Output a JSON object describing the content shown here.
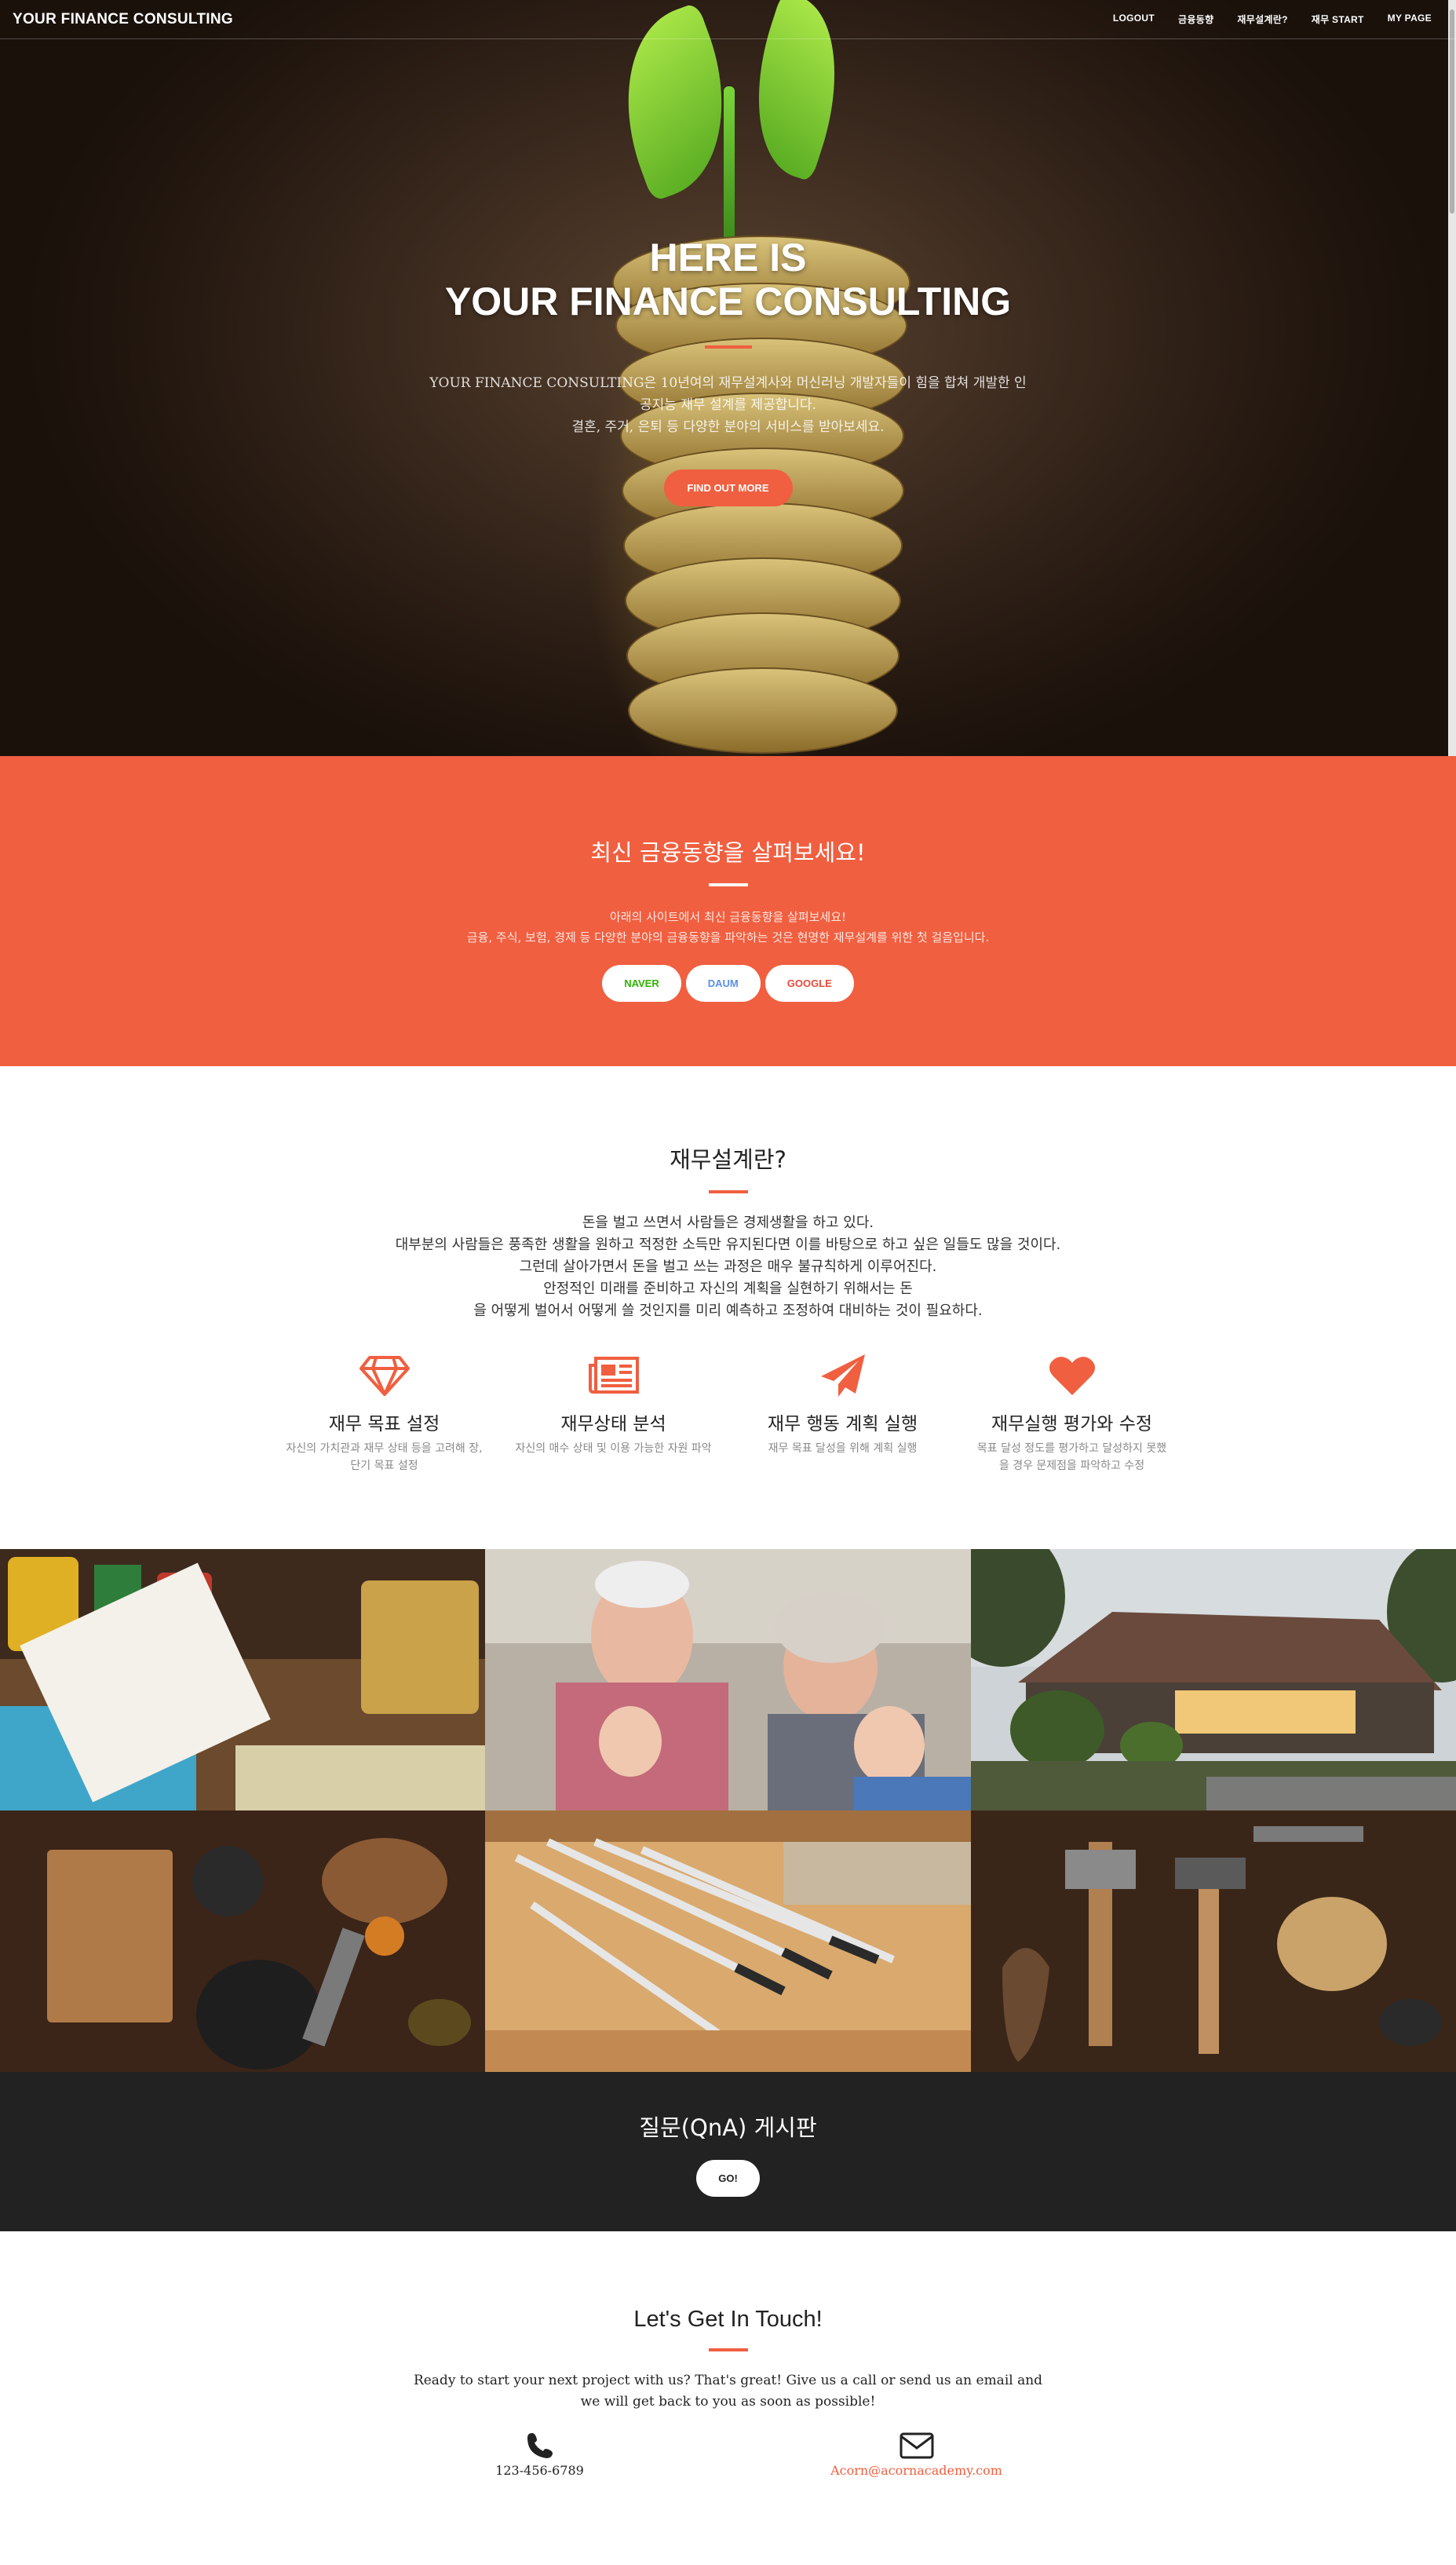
{
  "navbar": {
    "brand": "YOUR FINANCE CONSULTING",
    "links": [
      "LOGOUT",
      "금융동향",
      "재무설계란?",
      "재무 START",
      "MY PAGE"
    ]
  },
  "hero": {
    "title_line1": "HERE IS",
    "title_line2": "YOUR FINANCE CONSULTING",
    "text_line1": "YOUR FINANCE CONSULTING은 10년여의 재무설계사와 머신러닝 개발자들이 힘을 합쳐 개발한 인",
    "text_line2": "공지능 재무 설계를 제공합니다.",
    "text_line3": "결혼, 주거, 은퇴 등 다양한 분야의 서비스를 받아보세요.",
    "cta": "FIND OUT MORE"
  },
  "trends": {
    "title": "최신 금융동향을 살펴보세요!",
    "text_line1": "아래의 사이트에서 최신 금융동향을 살펴보세요!",
    "text_line2": "금융, 주식, 보험, 경제 등 다양한 분야의 금융동향을 파악하는 것은 현명한 재무설계를 위한 첫 걸음입니다.",
    "buttons": [
      {
        "label": "NAVER",
        "color": "#2db400"
      },
      {
        "label": "DAUM",
        "color": "#5a8fe8"
      },
      {
        "label": "GOOGLE",
        "color": "#e84a3b"
      }
    ]
  },
  "about": {
    "title": "재무설계란?",
    "lines": [
      "돈을 벌고 쓰면서 사람들은 경제생활을 하고 있다.",
      "대부분의 사람들은 풍족한 생활을 원하고 적정한 소득만 유지된다면 이를 바탕으로 하고 싶은 일들도 많을 것이다.",
      "그런데 살아가면서 돈을 벌고 쓰는 과정은 매우 불규칙하게 이루어진다.",
      "안정적인 미래를 준비하고 자신의 계획을 실현하기 위해서는 돈",
      "을 어떻게 벌어서 어떻게 쓸 것인지를 미리 예측하고 조정하여 대비하는 것이 필요하다."
    ],
    "services": [
      {
        "icon": "diamond-icon",
        "title": "재무 목표 설정",
        "text": "자신의 가치관과 재무 상태 등을 고려해 장,단기 목표 설정"
      },
      {
        "icon": "newspaper-icon",
        "title": "재무상태 분석",
        "text": "자신의 매수 상태 및 이용 가능한 자원 파악"
      },
      {
        "icon": "paper-plane-icon",
        "title": "재무 행동 계획 실행",
        "text": "재무 목표 달성을 위해 계획 실행"
      },
      {
        "icon": "heart-icon",
        "title": "재무실행 평가와 수정",
        "text": "목표 달성 정도를 평가하고 달성하지 못했을 경우 문제점을 파악하고 수정"
      }
    ]
  },
  "portfolio": {
    "tiles": [
      "receipt-groceries-photo",
      "grandparents-children-photo",
      "country-house-photo",
      "kitchen-tools-photo",
      "fountain-pens-photo",
      "hand-tools-photo"
    ]
  },
  "qna": {
    "title": "질문(QnA) 게시판",
    "button": "GO!"
  },
  "contact": {
    "title": "Let's Get In Touch!",
    "lead_line1": "Ready to start your next project with us? That's great! Give us a call or send us an email and",
    "lead_line2": "we will get back to you as soon as possible!",
    "phone": "123-456-6789",
    "email": "Acorn@acornacademy.com"
  },
  "colors": {
    "accent": "#f05f40",
    "dark": "#222222"
  }
}
